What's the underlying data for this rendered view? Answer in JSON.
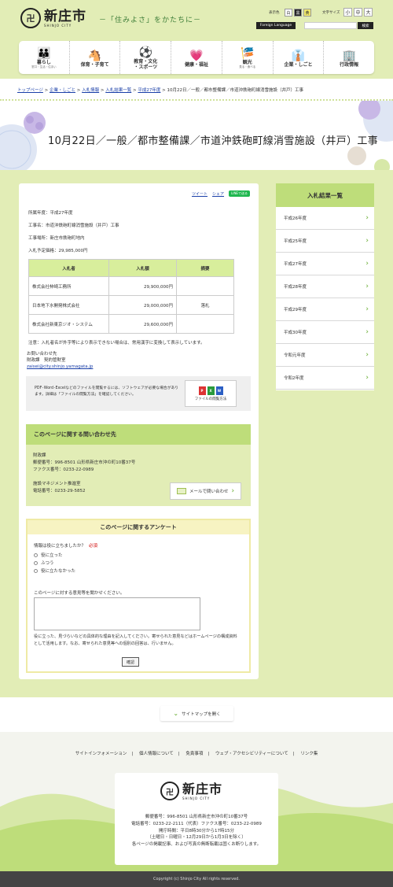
{
  "header": {
    "logo_mark": "卍",
    "logo_title": "新庄市",
    "logo_sub": "SHINJO CITY",
    "tagline": "－「住みよさ」をかたちに－",
    "color_label": "表示色",
    "colors": [
      "白",
      "黒",
      "黄"
    ],
    "size_label": "文字サイズ",
    "sizes": [
      "小",
      "中",
      "大"
    ],
    "foreign_label": "Foreign Language",
    "search_button": "検索",
    "nav": [
      {
        "label": "暮らし",
        "sub": "窓口・生活・住まい",
        "icon": "family-icon",
        "glyph": "👪"
      },
      {
        "label": "保育・子育て",
        "sub": "",
        "icon": "toys-icon",
        "glyph": "🐴"
      },
      {
        "label": "教育・文化\n・スポーツ",
        "sub": "",
        "icon": "education-icon",
        "glyph": "⚽"
      },
      {
        "label": "健康・福祉",
        "sub": "",
        "icon": "heart-hands-icon",
        "glyph": "💗"
      },
      {
        "label": "観光",
        "sub": "見る・食べる",
        "icon": "festival-icon",
        "glyph": "🎏"
      },
      {
        "label": "企業・しごと",
        "sub": "",
        "icon": "worker-icon",
        "glyph": "👔"
      },
      {
        "label": "行政情報",
        "sub": "",
        "icon": "city-hall-icon",
        "glyph": "🏢"
      }
    ]
  },
  "breadcrumb": {
    "items": [
      "トップページ",
      "企業・しごと",
      "入札情報",
      "入札結果一覧",
      "平成27年度"
    ],
    "current": "10月22日／一般／都市整備課／市道沖鉄砲町線消雪施設（井戸）工事"
  },
  "page_title": "10月22日／一般／都市整備課／市道沖鉄砲町線消雪施設（井戸）工事",
  "social": {
    "tweet": "ツイート",
    "share": "シェア",
    "line": "LINEで送る"
  },
  "details": {
    "year": "所属年度：平成27年度",
    "name": "工事名：市道沖鉄砲町線消雪施設（井戸）工事",
    "place": "工事場所：新庄市鉄砲町地内",
    "price": "入札予定価格：29,985,000円"
  },
  "bid_table": {
    "headers": [
      "入札者",
      "入札額",
      "摘要"
    ],
    "rows": [
      [
        "株式会社柿崎工務所",
        "29,900,000円",
        ""
      ],
      [
        "日本地下水開発株式会社",
        "29,000,000円",
        "落札"
      ],
      [
        "株式会社新東京ジオ・システム",
        "29,600,000円",
        ""
      ]
    ]
  },
  "note": "注意：入札者名が外字等により表示できない場合は、常用漢字に変換して表示しています。",
  "inquiry": {
    "label": "お問い合わせ先",
    "dept": "財政課　契約管財室",
    "email": "zaisei@city.shinjo.yamagata.jp"
  },
  "pdf": {
    "text": "PDF･Word･Excelなどのファイルを閲覧するには、ソフトウェアが必要な場合があります。詳細は「ファイルの閲覧方法」を確認してください。",
    "button": "ファイルの閲覧方法"
  },
  "contact": {
    "title": "このページに関する問い合わせ先",
    "lines": [
      "財政課",
      "郵便番号：996-8501 山形県新庄市沖の町10番37号",
      "ファクス番号：0233-22-0989",
      "",
      "施設マネジメント推進室",
      "電話番号：0233-29-5852"
    ],
    "mail_button": "メールで問い合わせ"
  },
  "survey": {
    "title": "このページに関するアンケート",
    "question": "情報は役に立ちましたか？",
    "required": "必須",
    "options": [
      "役に立った",
      "ふつう",
      "役に立たなかった"
    ],
    "opinion_label": "このページに対する意見等を聞かせください。",
    "note": "役に立った、見づらいなどの具体的な理由を記入してください。寄せられた意見などはホームページの構成資料として活用します。なお、寄せられた意見等への個別の回答は、行いません。",
    "confirm": "確認"
  },
  "sidebar": {
    "title": "入札結果一覧",
    "items": [
      "平成26年度",
      "平成25年度",
      "平成27年度",
      "平成28年度",
      "平成29年度",
      "平成30年度",
      "令和元年度",
      "令和2年度"
    ]
  },
  "sitemap_button": "サイトマップを開く",
  "footer": {
    "links": [
      "サイトインフォメーション",
      "個人情報について",
      "免責事項",
      "ウェブ・アクセシビリティーについて",
      "リンク集"
    ],
    "address_lines": [
      "郵便番号：996-8501 山形県新庄市沖の町10番37号",
      "電話番号：0233-22-2111（代表）ファクス番号：0233-22-0989",
      "開庁時間：平日8時30分から17時15分",
      "（土曜日・日曜日・12月29日から1月3日を除く）",
      "各ページの掲載記事、および写真の無断転載は固くお断りします。"
    ],
    "copyright": "Copyright (c) Shinjo City All rights reserved."
  },
  "colors": {
    "accent_green": "#bedd7a",
    "light_green": "#e2edb6",
    "survey_yellow": "#f7f3c2",
    "link_blue": "#1a3fa8"
  }
}
